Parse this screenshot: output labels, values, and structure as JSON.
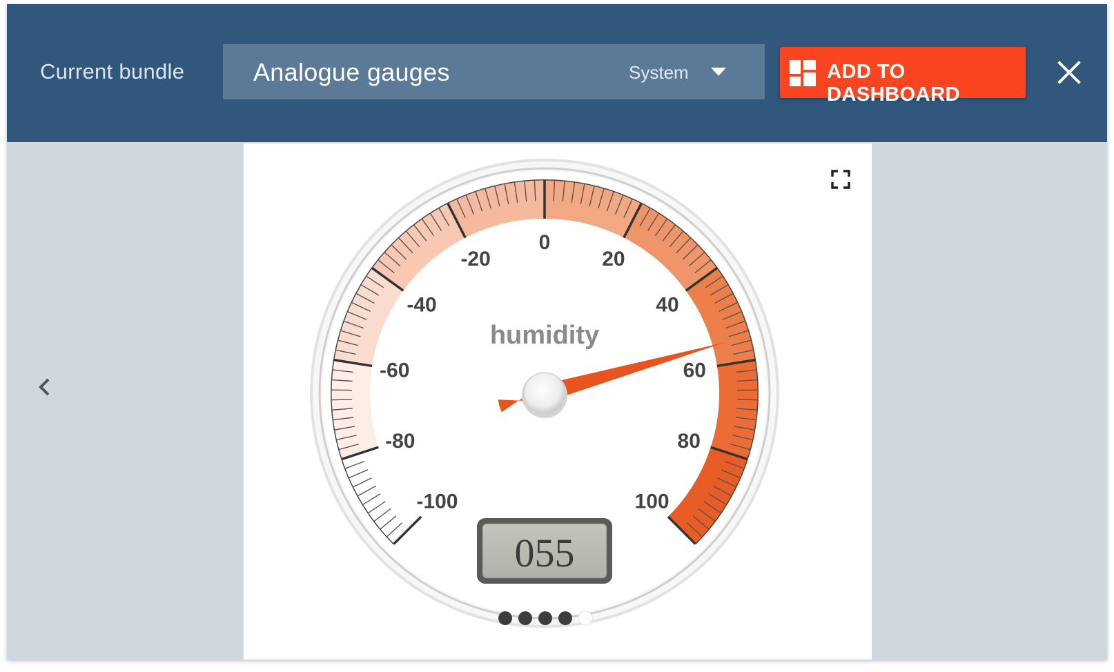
{
  "header": {
    "bundle_label": "Current bundle",
    "bundle_name": "Analogue gauges",
    "bundle_scope": "System",
    "add_button_label": "ADD TO DASHBOARD"
  },
  "icons": {
    "dropdown": "chevron-down-icon",
    "add": "dashboard-icon",
    "close": "close-icon",
    "previous": "chevron-left-icon",
    "fullscreen": "fullscreen-icon"
  },
  "colors": {
    "topbar": "#31577c",
    "select_bg": "#5a7a98",
    "accent_button": "#fb4521",
    "needle": "#e8541d",
    "page_bg": "#d0d8df"
  },
  "gauge": {
    "title": "humidity",
    "value": 55,
    "display": "055",
    "min": -100,
    "max": 100,
    "major_ticks": [
      -100,
      -80,
      -60,
      -40,
      -20,
      0,
      20,
      40,
      60,
      80,
      100
    ],
    "minor_ticks_per_major": 10,
    "highlights": [
      {
        "from": -80,
        "to": -60,
        "color": "#fdede7"
      },
      {
        "from": -60,
        "to": -40,
        "color": "#fadccf"
      },
      {
        "from": -40,
        "to": -20,
        "color": "#f8c8b3"
      },
      {
        "from": -20,
        "to": 0,
        "color": "#f5b99d"
      },
      {
        "from": 0,
        "to": 20,
        "color": "#f2a882"
      },
      {
        "from": 20,
        "to": 40,
        "color": "#f09469"
      },
      {
        "from": 40,
        "to": 60,
        "color": "#ed7f4a"
      },
      {
        "from": 60,
        "to": 80,
        "color": "#eb6d35"
      },
      {
        "from": 80,
        "to": 100,
        "color": "#e75d25"
      }
    ]
  },
  "carousel": {
    "page_count": 5,
    "active_index": 4
  }
}
